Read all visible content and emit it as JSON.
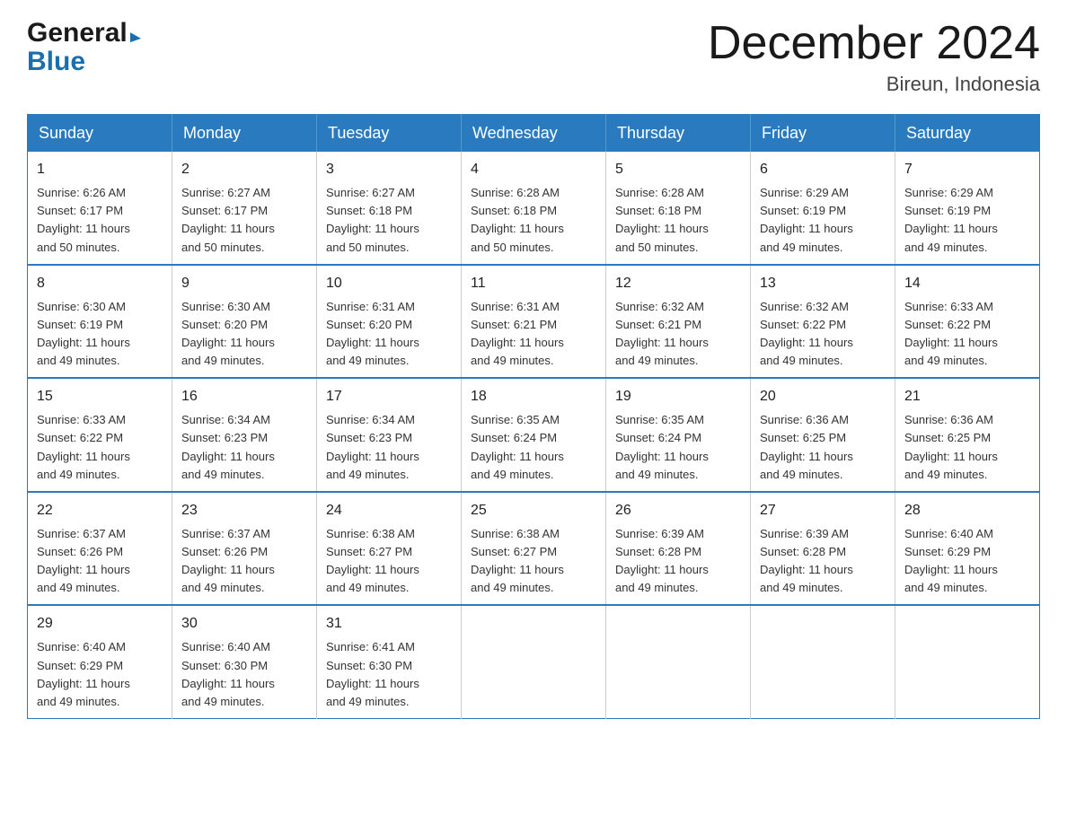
{
  "header": {
    "logo_general": "General",
    "logo_blue": "Blue",
    "month_title": "December 2024",
    "location": "Bireun, Indonesia"
  },
  "weekdays": [
    "Sunday",
    "Monday",
    "Tuesday",
    "Wednesday",
    "Thursday",
    "Friday",
    "Saturday"
  ],
  "weeks": [
    [
      {
        "day": "1",
        "sunrise": "6:26 AM",
        "sunset": "6:17 PM",
        "daylight": "11 hours and 50 minutes."
      },
      {
        "day": "2",
        "sunrise": "6:27 AM",
        "sunset": "6:17 PM",
        "daylight": "11 hours and 50 minutes."
      },
      {
        "day": "3",
        "sunrise": "6:27 AM",
        "sunset": "6:18 PM",
        "daylight": "11 hours and 50 minutes."
      },
      {
        "day": "4",
        "sunrise": "6:28 AM",
        "sunset": "6:18 PM",
        "daylight": "11 hours and 50 minutes."
      },
      {
        "day": "5",
        "sunrise": "6:28 AM",
        "sunset": "6:18 PM",
        "daylight": "11 hours and 50 minutes."
      },
      {
        "day": "6",
        "sunrise": "6:29 AM",
        "sunset": "6:19 PM",
        "daylight": "11 hours and 49 minutes."
      },
      {
        "day": "7",
        "sunrise": "6:29 AM",
        "sunset": "6:19 PM",
        "daylight": "11 hours and 49 minutes."
      }
    ],
    [
      {
        "day": "8",
        "sunrise": "6:30 AM",
        "sunset": "6:19 PM",
        "daylight": "11 hours and 49 minutes."
      },
      {
        "day": "9",
        "sunrise": "6:30 AM",
        "sunset": "6:20 PM",
        "daylight": "11 hours and 49 minutes."
      },
      {
        "day": "10",
        "sunrise": "6:31 AM",
        "sunset": "6:20 PM",
        "daylight": "11 hours and 49 minutes."
      },
      {
        "day": "11",
        "sunrise": "6:31 AM",
        "sunset": "6:21 PM",
        "daylight": "11 hours and 49 minutes."
      },
      {
        "day": "12",
        "sunrise": "6:32 AM",
        "sunset": "6:21 PM",
        "daylight": "11 hours and 49 minutes."
      },
      {
        "day": "13",
        "sunrise": "6:32 AM",
        "sunset": "6:22 PM",
        "daylight": "11 hours and 49 minutes."
      },
      {
        "day": "14",
        "sunrise": "6:33 AM",
        "sunset": "6:22 PM",
        "daylight": "11 hours and 49 minutes."
      }
    ],
    [
      {
        "day": "15",
        "sunrise": "6:33 AM",
        "sunset": "6:22 PM",
        "daylight": "11 hours and 49 minutes."
      },
      {
        "day": "16",
        "sunrise": "6:34 AM",
        "sunset": "6:23 PM",
        "daylight": "11 hours and 49 minutes."
      },
      {
        "day": "17",
        "sunrise": "6:34 AM",
        "sunset": "6:23 PM",
        "daylight": "11 hours and 49 minutes."
      },
      {
        "day": "18",
        "sunrise": "6:35 AM",
        "sunset": "6:24 PM",
        "daylight": "11 hours and 49 minutes."
      },
      {
        "day": "19",
        "sunrise": "6:35 AM",
        "sunset": "6:24 PM",
        "daylight": "11 hours and 49 minutes."
      },
      {
        "day": "20",
        "sunrise": "6:36 AM",
        "sunset": "6:25 PM",
        "daylight": "11 hours and 49 minutes."
      },
      {
        "day": "21",
        "sunrise": "6:36 AM",
        "sunset": "6:25 PM",
        "daylight": "11 hours and 49 minutes."
      }
    ],
    [
      {
        "day": "22",
        "sunrise": "6:37 AM",
        "sunset": "6:26 PM",
        "daylight": "11 hours and 49 minutes."
      },
      {
        "day": "23",
        "sunrise": "6:37 AM",
        "sunset": "6:26 PM",
        "daylight": "11 hours and 49 minutes."
      },
      {
        "day": "24",
        "sunrise": "6:38 AM",
        "sunset": "6:27 PM",
        "daylight": "11 hours and 49 minutes."
      },
      {
        "day": "25",
        "sunrise": "6:38 AM",
        "sunset": "6:27 PM",
        "daylight": "11 hours and 49 minutes."
      },
      {
        "day": "26",
        "sunrise": "6:39 AM",
        "sunset": "6:28 PM",
        "daylight": "11 hours and 49 minutes."
      },
      {
        "day": "27",
        "sunrise": "6:39 AM",
        "sunset": "6:28 PM",
        "daylight": "11 hours and 49 minutes."
      },
      {
        "day": "28",
        "sunrise": "6:40 AM",
        "sunset": "6:29 PM",
        "daylight": "11 hours and 49 minutes."
      }
    ],
    [
      {
        "day": "29",
        "sunrise": "6:40 AM",
        "sunset": "6:29 PM",
        "daylight": "11 hours and 49 minutes."
      },
      {
        "day": "30",
        "sunrise": "6:40 AM",
        "sunset": "6:30 PM",
        "daylight": "11 hours and 49 minutes."
      },
      {
        "day": "31",
        "sunrise": "6:41 AM",
        "sunset": "6:30 PM",
        "daylight": "11 hours and 49 minutes."
      },
      null,
      null,
      null,
      null
    ]
  ],
  "labels": {
    "sunrise_prefix": "Sunrise: ",
    "sunset_prefix": "Sunset: ",
    "daylight_prefix": "Daylight: "
  }
}
